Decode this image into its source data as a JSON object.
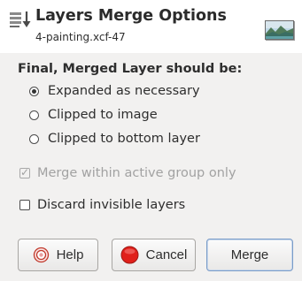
{
  "header": {
    "title": "Layers Merge Options",
    "subtitle": "4-painting.xcf-47",
    "icon": "merge-layers-icon",
    "thumbnail": "layer-preview-thumbnail"
  },
  "merge_options": {
    "section_label": "Final, Merged Layer should be:",
    "options": [
      {
        "label": "Expanded as necessary",
        "selected": true
      },
      {
        "label": "Clipped to image",
        "selected": false
      },
      {
        "label": "Clipped to bottom layer",
        "selected": false
      }
    ]
  },
  "checkboxes": {
    "merge_within_group": {
      "label": "Merge within active group only",
      "checked": true,
      "enabled": false
    },
    "discard_invisible": {
      "label": "Discard invisible layers",
      "checked": false,
      "enabled": true
    }
  },
  "buttons": {
    "help": "Help",
    "cancel": "Cancel",
    "merge": "Merge"
  },
  "colors": {
    "header_bg": "#ffffff",
    "dialog_bg": "#f2f1f0",
    "cancel_red": "#e0201b",
    "disabled_text": "#a2a2a2"
  }
}
